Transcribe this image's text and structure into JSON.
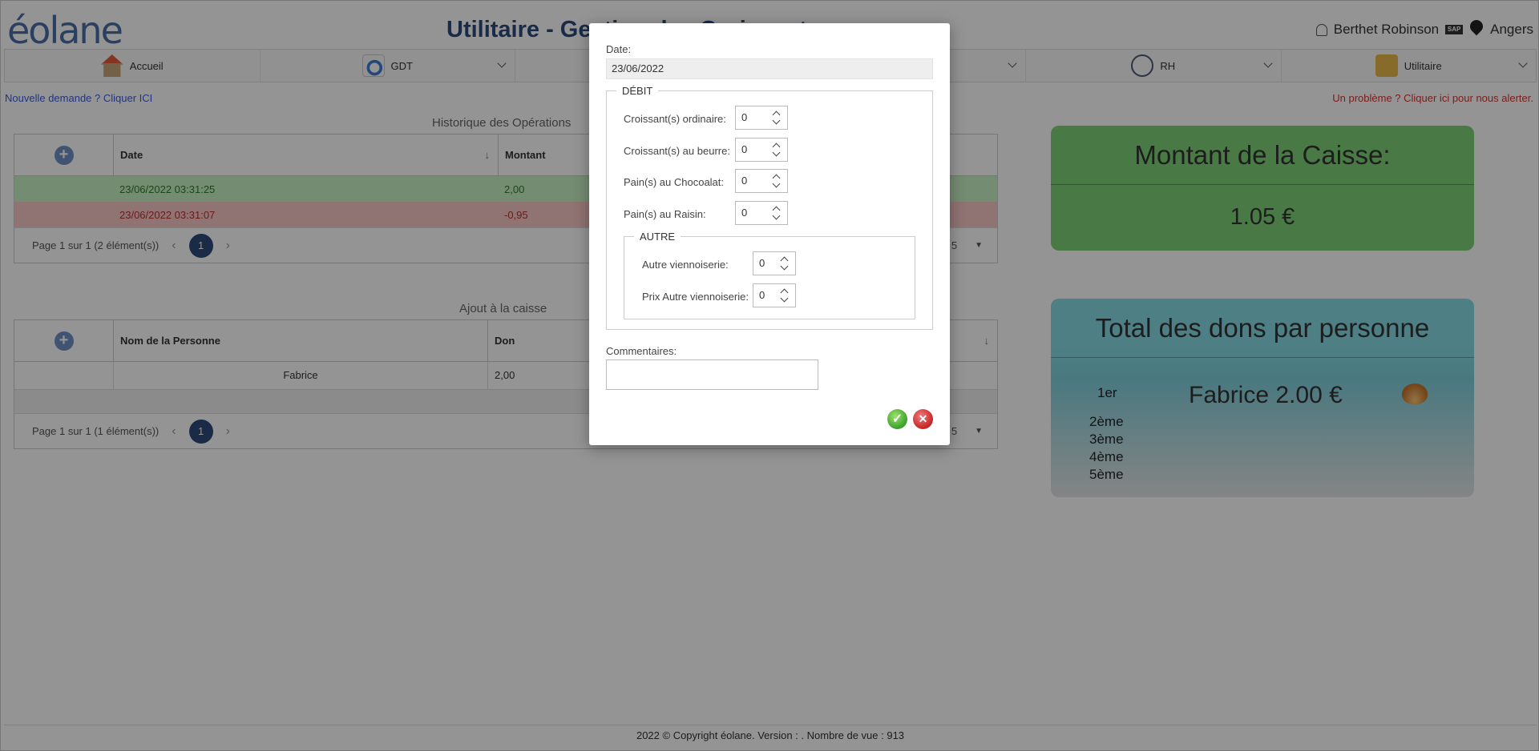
{
  "header": {
    "logo": "éolane",
    "title": "Utilitaire - Gestion des Croissants",
    "user_name": "Berthet Robinson",
    "sap_label": "SAP",
    "location": "Angers"
  },
  "nav": {
    "items": [
      {
        "label": "Accueil",
        "icon": "house-icon"
      },
      {
        "label": "GDT",
        "icon": "search-icon"
      },
      {
        "label": "",
        "icon": ""
      },
      {
        "label": "",
        "icon": ""
      },
      {
        "label": "RH",
        "icon": "rh-icon"
      },
      {
        "label": "Utilitaire",
        "icon": "toolbox-icon"
      }
    ]
  },
  "links": {
    "new_request": "Nouvelle demande ? Cliquer ICI",
    "problem": "Un problème ? Cliquer ici pour nous alerter."
  },
  "operations": {
    "title": "Historique des Opérations",
    "columns": [
      "Date",
      "Montant"
    ],
    "rows": [
      {
        "date": "23/06/2022 03:31:25",
        "amount": "2,00"
      },
      {
        "date": "23/06/2022 03:31:07",
        "amount": "-0,95"
      }
    ],
    "pager_text": "Page 1 sur 1 (2 élément(s))",
    "page": "1",
    "page_size": "5"
  },
  "donations": {
    "title": "Ajout à la caisse",
    "columns": [
      "Nom de la Personne",
      "Don"
    ],
    "rows": [
      {
        "name": "Fabrice",
        "don": "2,00"
      }
    ],
    "pager_text": "Page 1 sur 1 (1 élément(s))",
    "page": "1",
    "page_size": "5"
  },
  "cash_panel": {
    "title": "Montant de la Caisse:",
    "amount": "1.05 €"
  },
  "ranking_panel": {
    "title": "Total des dons par personne",
    "ranks": [
      "1er",
      "2ème",
      "3ème",
      "4ème",
      "5ème"
    ],
    "top_donor": "Fabrice 2.00 €"
  },
  "footer": {
    "text": "2022 © Copyright éolane. Version : . Nombre de vue : 913"
  },
  "modal": {
    "date_label": "Date:",
    "date_value": "23/06/2022",
    "debit_legend": "DÉBIT",
    "fields": [
      {
        "label": "Croissant(s) ordinaire:",
        "value": "0"
      },
      {
        "label": "Croissant(s) au beurre:",
        "value": "0"
      },
      {
        "label": "Pain(s) au Chocoalat:",
        "value": "0"
      },
      {
        "label": "Pain(s) au Raisin:",
        "value": "0"
      }
    ],
    "autre_legend": "AUTRE",
    "autre_fields": [
      {
        "label": "Autre viennoiserie:",
        "value": "0"
      },
      {
        "label": "Prix Autre viennoiserie:",
        "value": "0"
      }
    ],
    "comment_label": "Commentaires:",
    "comment_value": ""
  }
}
